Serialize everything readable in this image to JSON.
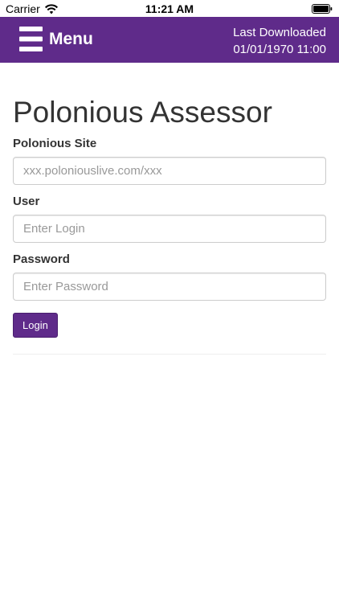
{
  "status_bar": {
    "carrier": "Carrier",
    "time": "11:21 AM",
    "icons": [
      "wifi-icon",
      "battery-icon"
    ]
  },
  "header": {
    "menu_label": "Menu",
    "last_downloaded_label": "Last Downloaded",
    "last_downloaded_value": "01/01/1970 11:00",
    "background_color": "#5f2b8a"
  },
  "form": {
    "title": "Polonious Assessor",
    "site": {
      "label": "Polonious Site",
      "placeholder": "xxx.poloniouslive.com/xxx",
      "value": ""
    },
    "user": {
      "label": "User",
      "placeholder": "Enter Login",
      "value": ""
    },
    "password": {
      "label": "Password",
      "placeholder": "Enter Password",
      "value": ""
    },
    "login_label": "Login",
    "accent_color": "#5f2b8a"
  }
}
